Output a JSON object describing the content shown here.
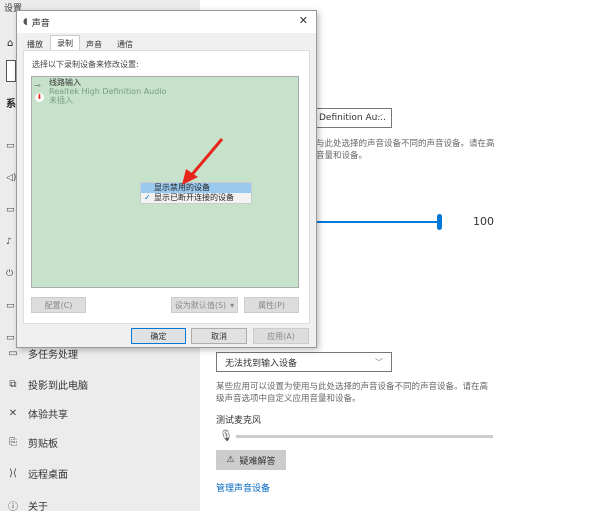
{
  "window": {
    "title": "设置"
  },
  "sidebar": {
    "heading_partial": "系",
    "items": [
      {
        "label": "多任务处理",
        "icon": "multitask-icon",
        "glyph": "▭"
      },
      {
        "label": "投影到此电脑",
        "icon": "project-icon",
        "glyph": "⧉"
      },
      {
        "label": "体验共享",
        "icon": "share-icon",
        "glyph": "✕"
      },
      {
        "label": "剪贴板",
        "icon": "clipboard-icon",
        "glyph": "📋"
      },
      {
        "label": "远程桌面",
        "icon": "remote-desktop-icon",
        "glyph": "✕"
      },
      {
        "label": "关于",
        "icon": "info-icon",
        "glyph": "ⓘ"
      }
    ]
  },
  "output": {
    "device_dropdown": "Definition Au...",
    "description": "某些应用可以设置为使用与此处选择的声音设备不同的声音设备。请在高级声音选项中自定义应用音量和设备。",
    "description_visible_1": "与此处选择的声音设备不同的声音设备。请在高",
    "description_visible_2": "音量和设备。",
    "volume": 100,
    "volume_label": "100"
  },
  "input": {
    "device_dropdown": "无法找到输入设备",
    "description_1": "某些应用可以设置为使用与此处选择的声音设备不同的声音设备。请在高",
    "description_2": "级声音选项中自定义应用音量和设备。",
    "test_mic_label": "测试麦克风",
    "mic_level": 0,
    "troubleshoot_label": "疑难解答",
    "manage_link": "管理声音设备"
  },
  "dialog": {
    "title": "声音",
    "tabs": [
      "播放",
      "录制",
      "声音",
      "通信"
    ],
    "active_tab": 1,
    "instruction": "选择以下录制设备来修改设置:",
    "device": {
      "name": "线路输入",
      "driver": "Realtek High Definition Audio",
      "status": "未插入"
    },
    "context_menu": [
      {
        "label": "显示禁用的设备",
        "checked": false,
        "highlighted": true
      },
      {
        "label": "显示已断开连接的设备",
        "checked": true,
        "highlighted": false
      }
    ],
    "buttons": {
      "configure": "配置(C)",
      "set_default": "设为默认值(S)",
      "properties": "属性(P)",
      "ok": "确定",
      "cancel": "取消",
      "apply": "应用(A)"
    }
  },
  "colors": {
    "accent": "#0078d7",
    "list_bg": "#c7e2cb",
    "arrow": "#e8251c"
  }
}
